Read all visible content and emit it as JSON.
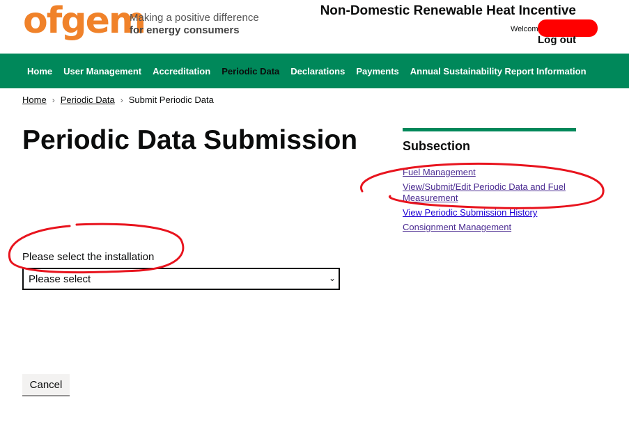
{
  "header": {
    "logo": "ofgem",
    "tagline_line1": "Making a positive difference",
    "tagline_line2": "for energy consumers",
    "service_name": "Non-Domestic Renewable Heat Incentive",
    "welcome": "Welcome",
    "logout": "Log out"
  },
  "nav": {
    "items": [
      {
        "label": "Home"
      },
      {
        "label": "User Management"
      },
      {
        "label": "Accreditation"
      },
      {
        "label": "Periodic Data"
      },
      {
        "label": "Declarations"
      },
      {
        "label": "Payments"
      },
      {
        "label": "Annual Sustainability Report Information"
      }
    ],
    "active": "Periodic Data"
  },
  "breadcrumb": [
    "Home",
    "Periodic Data",
    "Submit Periodic Data"
  ],
  "page": {
    "title": "Periodic Data Submission"
  },
  "subsection": {
    "title": "Subsection",
    "links": [
      "Fuel Management",
      "View/Submit/Edit Periodic Data and Fuel Measurement",
      "View Periodic Submission History",
      "Consignment Management"
    ]
  },
  "form": {
    "select_label": "Please select the installation",
    "select_value": "Please select",
    "cancel": "Cancel"
  },
  "colors": {
    "brand_orange": "#f0822a",
    "nav_green": "#00885a",
    "annotation_red": "#e8141e",
    "link_purple": "#4c2c92"
  }
}
